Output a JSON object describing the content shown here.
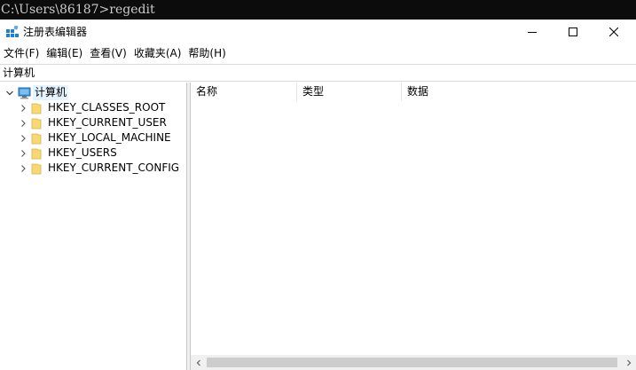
{
  "console": {
    "text": "C:\\Users\\86187>regedit"
  },
  "window": {
    "title": "注册表编辑器",
    "controls": {
      "minimize": "minimize",
      "maximize": "maximize",
      "close": "close"
    }
  },
  "menu": [
    {
      "label": "文件(F)"
    },
    {
      "label": "编辑(E)"
    },
    {
      "label": "查看(V)"
    },
    {
      "label": "收藏夹(A)"
    },
    {
      "label": "帮助(H)"
    }
  ],
  "address": {
    "path": "计算机"
  },
  "tree": {
    "root": {
      "label": "计算机",
      "icon": "computer-icon",
      "expanded": true
    },
    "children": [
      {
        "label": "HKEY_CLASSES_ROOT",
        "icon": "folder-icon"
      },
      {
        "label": "HKEY_CURRENT_USER",
        "icon": "folder-icon"
      },
      {
        "label": "HKEY_LOCAL_MACHINE",
        "icon": "folder-icon"
      },
      {
        "label": "HKEY_USERS",
        "icon": "folder-icon"
      },
      {
        "label": "HKEY_CURRENT_CONFIG",
        "icon": "folder-icon"
      }
    ]
  },
  "list": {
    "columns": [
      "名称",
      "类型",
      "数据"
    ]
  },
  "colors": {
    "console_bg": "#0c0c0c",
    "console_text": "#cccccc",
    "folder": "#f8d775",
    "selection": "#e5f3ff",
    "app_icon": "#1e7fd8"
  }
}
